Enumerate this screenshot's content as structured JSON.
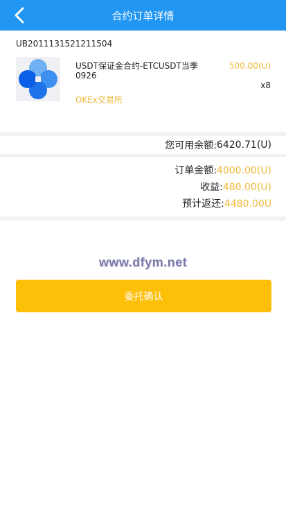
{
  "header": {
    "title": "合约订单详情",
    "background": "#2196f3"
  },
  "order": {
    "id": "UB2011131521211504"
  },
  "product": {
    "name": "USDT保证金合约-ETCUSDT当季0926",
    "price": "500.00(U)",
    "quantity": "x8",
    "exchange": "OKEx交易所"
  },
  "balance": {
    "label": "您可用余额:",
    "value": "6420.71(U)"
  },
  "summary": {
    "order_amount_label": "订单金额:",
    "order_amount_value": "4000.00(U)",
    "profit_label": "收益:",
    "profit_value": "480.00(U)",
    "expected_return_label": "预计返还:",
    "expected_return_value": "4480.00U"
  },
  "watermark": "www.dfym.net",
  "confirm_button": {
    "label": "委托确认",
    "color": "#fdbf08"
  },
  "accent_color": "#f0b93b"
}
